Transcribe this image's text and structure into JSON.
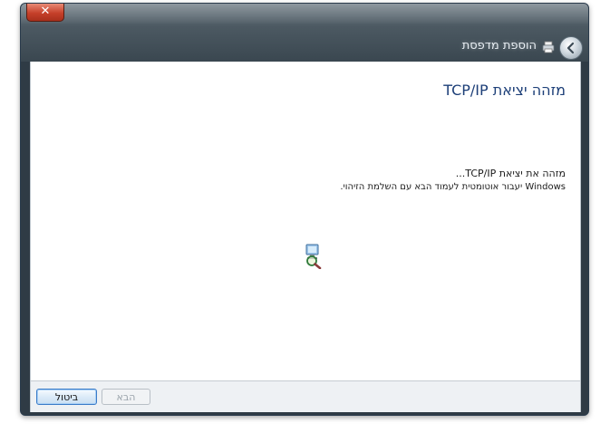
{
  "window": {
    "title": "הוספת מדפסת",
    "close_glyph": "✕"
  },
  "page": {
    "title": "מזהה יציאת TCP/IP",
    "status_line1": "מזהה את יציאת TCP/IP...",
    "status_line2": "Windows יעבור אוטומטית לעמוד הבא עם השלמת הזיהוי."
  },
  "icons": {
    "back": "back-arrow-icon",
    "wizard": "printer-icon",
    "progress": "search-computer-icon",
    "close": "close-icon"
  },
  "buttons": {
    "cancel_label": "ביטול",
    "next_label": "הבא"
  },
  "colors": {
    "title_blue": "#1d3f78",
    "close_red": "#c6402a",
    "focus_blue": "#3a7bc8"
  }
}
